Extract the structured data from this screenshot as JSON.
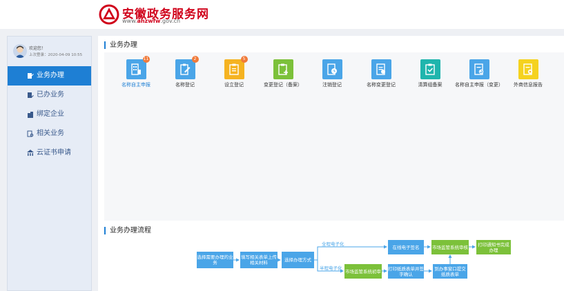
{
  "header": {
    "site_title": "安徽政务服务网",
    "url_prefix": "www.",
    "url_domain": "ahzwfw",
    "url_suffix": ".gov.cn",
    "brand_color": "#d0021b"
  },
  "user": {
    "welcome": "欢迎您！",
    "last_login": "上次登录：2020-04-09 10:55"
  },
  "sidebar": {
    "items": [
      {
        "label": "业务办理",
        "icon": "edit-doc-icon",
        "active": true
      },
      {
        "label": "已办业务",
        "icon": "doc-pen-icon",
        "active": false
      },
      {
        "label": "绑定企业",
        "icon": "building-icon",
        "active": false
      },
      {
        "label": "相关业务",
        "icon": "doc-search-icon",
        "active": false
      },
      {
        "label": "云证书申请",
        "icon": "bank-icon",
        "active": false
      }
    ]
  },
  "business": {
    "title": "业务办理",
    "tiles": [
      {
        "label": "名称自主申报",
        "color": "#4aa5e8",
        "badge": "11",
        "icon": "building-form-icon"
      },
      {
        "label": "名称登记",
        "color": "#4aa5e8",
        "badge": "2",
        "icon": "clipboard-pen-icon"
      },
      {
        "label": "设立登记",
        "color": "#f5b321",
        "badge": "5",
        "icon": "clipboard-list-icon"
      },
      {
        "label": "变更登记（备案）",
        "color": "#7cc13a",
        "badge": "",
        "icon": "clipboard-change-icon"
      },
      {
        "label": "注销登记",
        "color": "#4aa5e8",
        "badge": "",
        "icon": "doc-clock-icon"
      },
      {
        "label": "名称变更登记",
        "color": "#4aa5e8",
        "badge": "",
        "icon": "doc-edit-icon"
      },
      {
        "label": "清算组备案",
        "color": "#1fb5ad",
        "badge": "",
        "icon": "clipboard-check-icon"
      },
      {
        "label": "名称自主申报（变更）",
        "color": "#4aa5e8",
        "badge": "",
        "icon": "doc-refresh-icon"
      },
      {
        "label": "外商信息报告",
        "color": "#f5d21f",
        "badge": "",
        "icon": "doc-close-icon"
      }
    ]
  },
  "flow": {
    "title": "业务办理流程",
    "steps": {
      "s1": "选择需要办理的业务",
      "s2": "填写相关表单上传相关材料",
      "s3": "选择办理方式",
      "s4": "在线电子签名",
      "s5": "市场监管系统审核",
      "s6": "打印通知书完成办理",
      "s7": "市场监管系统初审",
      "s8": "打印纸质表单并签字确认",
      "s9": "到办事窗口提交纸质表单"
    },
    "branch_full": "全程电子化",
    "branch_half": "半程电子化"
  }
}
